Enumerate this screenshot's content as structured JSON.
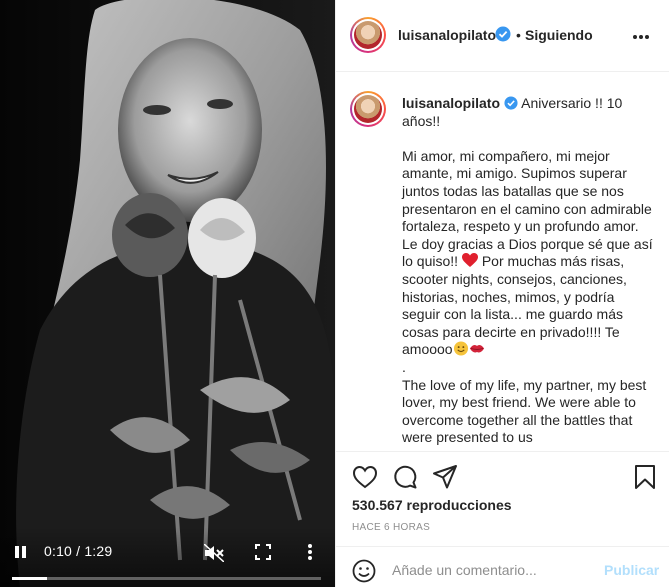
{
  "video": {
    "time": "0:10 / 1:29",
    "progress": 0.112
  },
  "header": {
    "username": "luisanalopilato",
    "separator": "•",
    "follow_label": "Siguiendo",
    "options_icon": "more-horizontal-icon"
  },
  "post": {
    "username": "luisanalopilato",
    "caption_first": "Aniversario !! 10 años!!",
    "caption_p1": "Mi amor, mi compañero, mi mejor amante, mi amigo. Supimos superar juntos todas las batallas que se nos presentaron en el camino con admirable fortaleza, respeto y un profundo amor. Le doy gracias a Dios porque sé que así lo quiso!!",
    "caption_p2": "Por muchas más risas, scooter nights, consejos, canciones, historias, noches, mimos, y podría seguir con la lista... me guardo más cosas para decirte en privado!!!! Te amoooo",
    "caption_dot": ".",
    "caption_en": "The love of my life, my partner, my best lover, my best friend. We were able to overcome together all the battles that were presented to us"
  },
  "stats": {
    "views": "530.567 reproducciones",
    "time_ago": "HACE 6 HORAS"
  },
  "comment_box": {
    "placeholder": "Añade un comentario...",
    "publish_label": "Publicar"
  },
  "colors": {
    "verified": "#3897f0",
    "publish_disabled": "#b2dffc",
    "heart_emoji": "#e0202e"
  }
}
